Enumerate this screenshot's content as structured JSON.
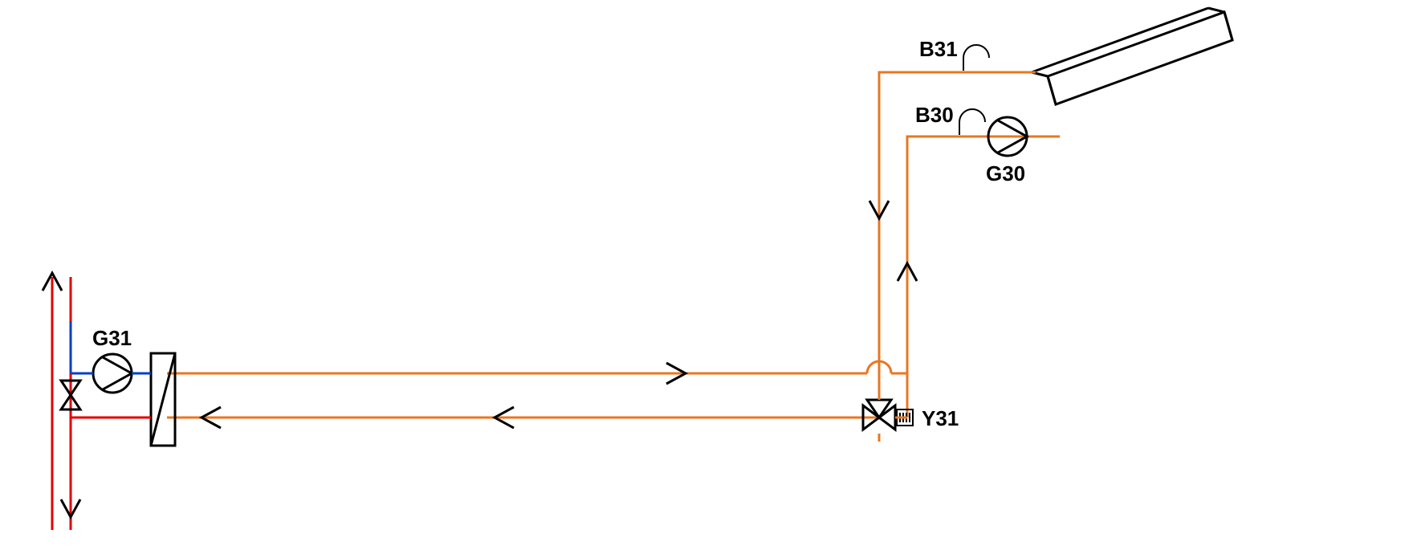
{
  "labels": {
    "b31": "B31",
    "b30": "B30",
    "g30": "G30",
    "g31": "G31",
    "y31": "Y31"
  },
  "components": {
    "pumps": [
      "G30",
      "G31"
    ],
    "sensors": [
      "B30",
      "B31"
    ],
    "valves": [
      "Y31"
    ],
    "heat_exchangers": 1,
    "solar_collector": 1,
    "check_valve": 1
  },
  "pipe_colors": {
    "solar_loop": "#E87722",
    "heating_supply": "#E30000",
    "heating_return": "#0040C0"
  }
}
